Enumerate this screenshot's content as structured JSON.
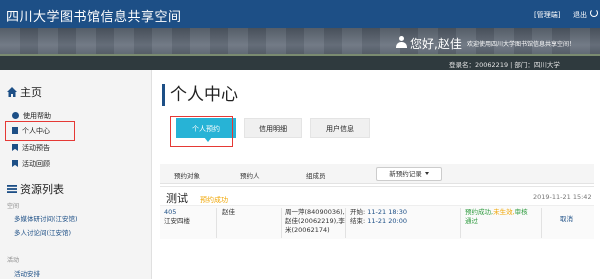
{
  "header": {
    "app_title": "四川大学图书馆信息共享空间",
    "admin_link": "[管理端]",
    "logout": "退出",
    "greeting": "您好,赵佳",
    "welcome": "欢迎使用四川大学图书馆信息共享空间！",
    "account_info": "登录名：20062219 | 部门：四川大学"
  },
  "sidebar": {
    "home_heading": "主页",
    "home_items": [
      {
        "label": "使用帮助",
        "icon": "question-circle-icon"
      },
      {
        "label": "个人中心",
        "icon": "user-icon"
      },
      {
        "label": "活动预告",
        "icon": "bookmark-icon"
      },
      {
        "label": "活动回顾",
        "icon": "bookmark-icon"
      }
    ],
    "resource_heading": "资源列表",
    "space_label": "空间",
    "space_items": [
      "多媒体研讨间(江安馆)",
      "多人讨论间(江安馆)"
    ],
    "activity_label": "活动",
    "activity_items": [
      "活动安排"
    ]
  },
  "main": {
    "page_title": "个人中心",
    "tabs": [
      {
        "label": "个人预约",
        "active": true
      },
      {
        "label": "信用明细",
        "active": false
      },
      {
        "label": "用户信息",
        "active": false
      }
    ],
    "table_headers": [
      "预约对象",
      "预约人",
      "组成员"
    ],
    "filter_dropdown": "新预约记录",
    "record": {
      "title": "测试",
      "status_badge": "预约成功",
      "created_time": "2019-11-21 15:42",
      "room": "405",
      "building": "江安四楼",
      "reserver": "赵佳",
      "members_line1": "周一萍(84090036),",
      "members_line2": "赵佳(20062219),李",
      "members_line3": "米(20062174)",
      "start_label": "开始:",
      "start_time": "11-21 18:30",
      "end_label": "结束:",
      "end_time": "11-21 20:00",
      "status_line1a": "预约成功,",
      "status_line1b": "未生效,",
      "status_line1c": "审核",
      "status_line2": "通过",
      "action": "取消"
    }
  },
  "colors": {
    "brand_blue": "#1d4f86",
    "tab_active": "#27b3d6",
    "highlight_red": "#e53935",
    "badge_orange": "#f0a500",
    "success_green": "#2e9b3e"
  }
}
